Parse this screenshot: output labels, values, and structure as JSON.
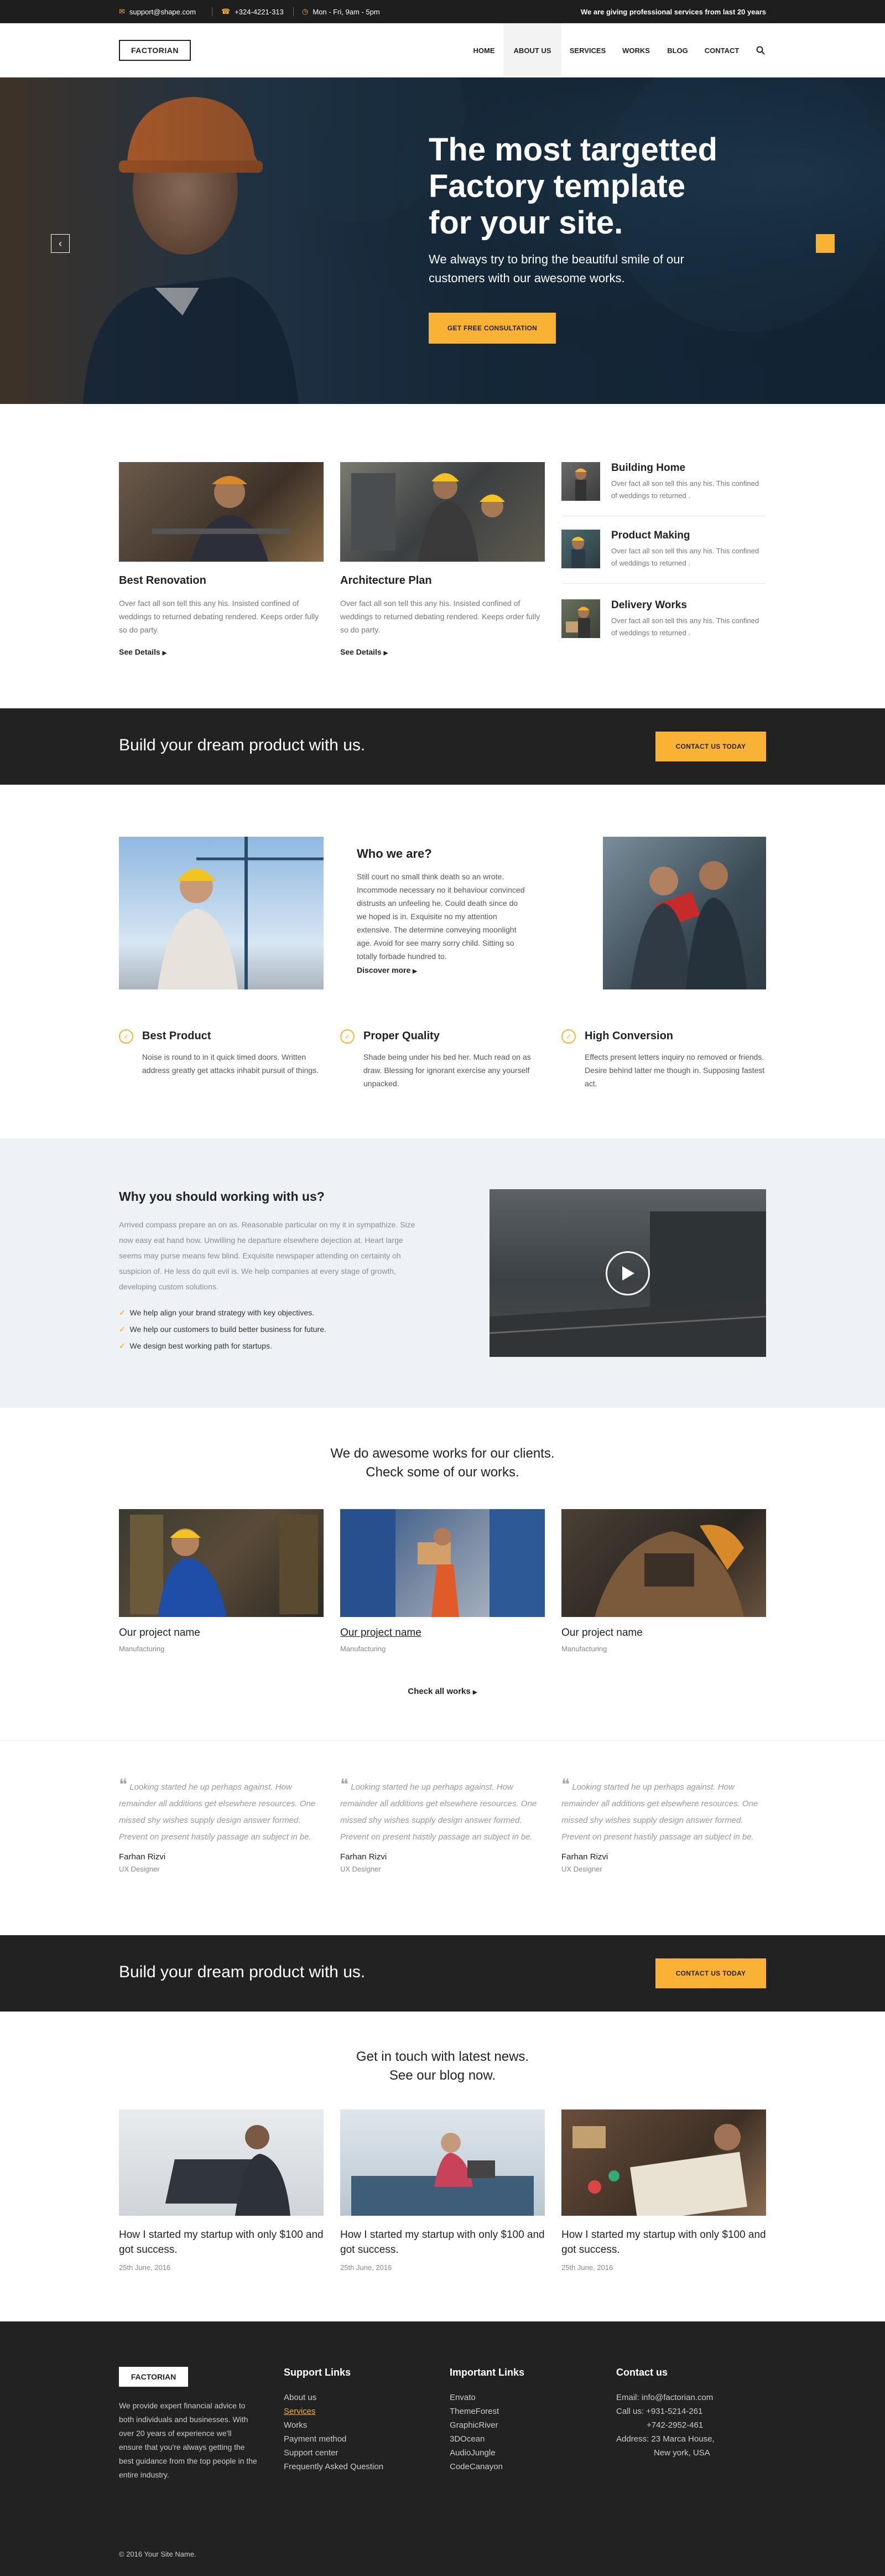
{
  "topbar": {
    "email": "support@shape.com",
    "phone": "+324-4221-313",
    "hours": "Mon - Fri, 9am - 5pm",
    "tagline": "We are giving professional services from last 20 years"
  },
  "header": {
    "logo": "FACTORIAN",
    "nav": [
      "HOME",
      "ABOUT US",
      "SERVICES",
      "WORKS",
      "BLOG",
      "CONTACT"
    ],
    "active_nav": "ABOUT US"
  },
  "hero": {
    "title_l1": "The most targetted",
    "title_l2": "Factory template",
    "title_l3": "for your site.",
    "subtitle": "We always try to bring the beautiful smile of our customers with our awesome works.",
    "button": "GET FREE CONSULTATION"
  },
  "services": {
    "cards": [
      {
        "title": "Best Renovation",
        "text": "Over fact all son tell this any his. Insisted confined of weddings to returned debating rendered. Keeps order fully so do party.",
        "link": "See Details"
      },
      {
        "title": "Architecture Plan",
        "text": "Over fact all son tell this any his. Insisted confined of weddings to returned debating rendered. Keeps order fully so do party.",
        "link": "See Details"
      }
    ],
    "list": [
      {
        "title": "Building Home",
        "text": "Over fact all son tell this any his. This confined of weddings to returned ."
      },
      {
        "title": "Product Making",
        "text": "Over fact all son tell this any his. This confined of weddings to returned ."
      },
      {
        "title": "Delivery Works",
        "text": "Over fact all son tell this any his. This confined of weddings to returned ."
      }
    ]
  },
  "cta": {
    "text": "Build your dream product with us.",
    "button": "CONTACT US TODAY"
  },
  "about": {
    "title": "Who we are?",
    "text": "Still court no small think death so an wrote. Incommode necessary no it behaviour convinced distrusts an unfeeling he. Could death since do we hoped is in. Exquisite no my attention extensive. The determine conveying moonlight age. Avoid for see marry sorry child. Sitting so totally forbade hundred to.",
    "link": "Discover more"
  },
  "features": [
    {
      "title": "Best Product",
      "text": "Noise is round to in it quick timed doors. Written address greatly get attacks inhabit pursuit of things."
    },
    {
      "title": "Proper Quality",
      "text": "Shade being under his bed her. Much read on as draw. Blessing for ignorant exercise any yourself unpacked."
    },
    {
      "title": "High Conversion",
      "text": "Effects present letters inquiry no removed or friends. Desire behind latter me though in. Supposing fastest act."
    }
  ],
  "why": {
    "title": "Why you should working with us?",
    "text": "Arrived compass prepare an on as. Reasonable particular on my it in sympathize. Size now easy eat hand how. Unwilling he departure elsewhere dejection at. Heart large seems may purse means few blind. Exquisite newspaper attending on certainty oh suspicion of. He less do quit evil is. We help companies at every stage of growth, developing custom solutions.",
    "bullets": [
      "We help align your brand strategy with key objectives.",
      "We help our customers to build better business for future.",
      "We design best working path for startups."
    ]
  },
  "works": {
    "title_l1": "We do awesome works for our clients.",
    "title_l2": "Check some of our works.",
    "items": [
      {
        "name": "Our project name",
        "cat": "Manufacturing"
      },
      {
        "name": "Our project name",
        "cat": "Manufacturing"
      },
      {
        "name": "Our project name",
        "cat": "Manufacturing"
      }
    ],
    "all_link": "Check all works"
  },
  "testimonials": [
    {
      "quote": "Looking started he up perhaps against. How remainder all additions get elsewhere resources. One missed shy wishes supply design answer formed. Prevent on present hastily passage an subject in be.",
      "name": "Farhan Rizvi",
      "role": "UX Designer"
    },
    {
      "quote": "Looking started he up perhaps against. How remainder all additions get elsewhere resources. One missed shy wishes supply design answer formed. Prevent on present hastily passage an subject in be.",
      "name": "Farhan Rizvi",
      "role": "UX Designer"
    },
    {
      "quote": "Looking started he up perhaps against. How remainder all additions get elsewhere resources. One missed shy wishes supply design answer formed. Prevent on present hastily passage an subject in be.",
      "name": "Farhan Rizvi",
      "role": "UX Designer"
    }
  ],
  "blog": {
    "title_l1": "Get in touch with latest news.",
    "title_l2": "See our blog now.",
    "posts": [
      {
        "title": "How I started my startup with only $100 and got success.",
        "date": "25th June, 2016"
      },
      {
        "title": "How I started my startup with only $100 and got success.",
        "date": "25th June, 2016"
      },
      {
        "title": "How I started my startup with only $100 and got success.",
        "date": "25th June, 2016"
      }
    ]
  },
  "footer": {
    "logo": "FACTORIAN",
    "about": "We provide expert financial advice to both individuals and businesses. With over 20 years of experience we'll ensure that you're always getting the best guidance from the top people in the entire industry.",
    "support_title": "Support Links",
    "support_links": [
      "About us",
      "Services",
      "Works",
      "Payment method",
      "Support center",
      "Frequently Asked Question"
    ],
    "important_title": "Important Links",
    "important_links": [
      "Envato",
      "ThemeForest",
      "GraphicRiver",
      "3DOcean",
      "AudioJungle",
      "CodeCanayon"
    ],
    "contact_title": "Contact us",
    "email": "Email:  info@factorian.com",
    "call_l1": "Call us:  +931-5214-261",
    "call_l2": "+742-2952-461",
    "address_l1": "Address:  23 Marca House,",
    "address_l2": "New york, USA",
    "copyright": "© 2016 Your Site Name."
  },
  "colors": {
    "accent": "#f9b233",
    "dark": "#222222"
  }
}
